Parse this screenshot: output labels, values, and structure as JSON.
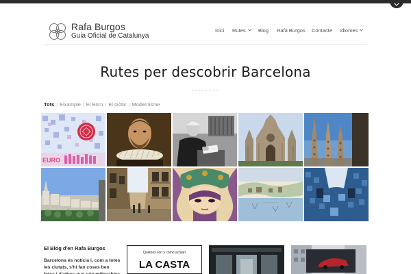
{
  "brand": {
    "name": "Rafa Burgos",
    "subtitle": "Guia Oficial de Catalunya"
  },
  "nav": {
    "items": [
      {
        "label": "Inici",
        "dropdown": false
      },
      {
        "label": "Rutes",
        "dropdown": true
      },
      {
        "label": "Blog",
        "dropdown": false
      },
      {
        "label": "Rafa Burgos",
        "dropdown": false
      },
      {
        "label": "Contacte",
        "dropdown": false
      },
      {
        "label": "Idiomes",
        "dropdown": true
      }
    ]
  },
  "hero": {
    "title": "Rutes per descobrir Barcelona"
  },
  "filters": {
    "items": [
      {
        "label": "Tots",
        "active": true
      },
      {
        "label": "Eixample",
        "active": false
      },
      {
        "label": "El Born",
        "active": false
      },
      {
        "label": "El Gòtic",
        "active": false
      },
      {
        "label": "Modernisme",
        "active": false
      }
    ]
  },
  "gallery": {
    "tiles": [
      {
        "subject": "barcelona-tile-mosaic",
        "overlay_text": "EURO"
      },
      {
        "subject": "cervantes-portrait"
      },
      {
        "subject": "man-writing-bw-photo"
      },
      {
        "subject": "gothic-cathedral"
      },
      {
        "subject": "sagrada-familia-towers"
      },
      {
        "subject": "barcelona-skyline-rooftop"
      },
      {
        "subject": "narrow-street-balconies"
      },
      {
        "subject": "art-nouveau-woman-poster"
      },
      {
        "subject": "port-old-map"
      },
      {
        "subject": "casa-batllo-courtyard"
      }
    ]
  },
  "blog": {
    "title": "El Blog d'en Rafa Burgos",
    "text": "Barcelona és notícia i, com a totes les ciutats, s'hi fan coses ben fetes i d'altres que són millorables"
  },
  "posts": [
    {
      "subject": "la-casta-book-cover",
      "kicker": "Quiénes son y cómo actúan",
      "headline": "LA CASTA"
    },
    {
      "subject": "shop-front-night"
    },
    {
      "subject": "building-billboard"
    }
  ],
  "colors": {
    "topbar": "#2b2b2b",
    "text": "#222222",
    "muted": "#888888",
    "divider": "#e2e2e2"
  }
}
